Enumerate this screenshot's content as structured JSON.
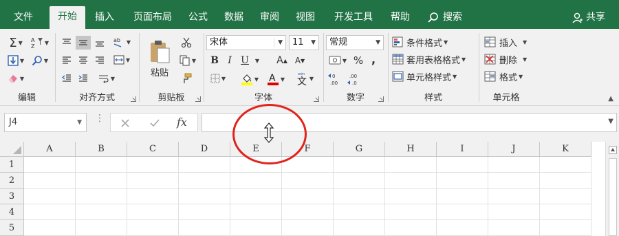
{
  "tabs": [
    "文件",
    "开始",
    "插入",
    "页面布局",
    "公式",
    "数据",
    "审阅",
    "视图",
    "开发工具",
    "帮助"
  ],
  "active_tab": "开始",
  "search_label": "搜索",
  "share_label": "共享",
  "groups": {
    "editing": "编辑",
    "alignment": "对齐方式",
    "clipboard": "剪贴板",
    "font": "字体",
    "number": "数字",
    "styles": "样式",
    "cells": "单元格"
  },
  "clipboard": {
    "paste": "粘贴"
  },
  "font": {
    "name": "宋体",
    "size": "11",
    "bold": "B",
    "italic": "I",
    "underline": "U",
    "font_color": "A",
    "grow": "A",
    "shrink": "A",
    "phonetic": "文"
  },
  "number": {
    "format": "常规",
    "percent": "%",
    "comma": ",",
    "inc_decimal": ".00",
    "dec_decimal": ".00"
  },
  "styles": {
    "conditional": "条件格式",
    "table": "套用表格格式",
    "cell_styles": "单元格样式"
  },
  "cells": {
    "insert": "插入",
    "delete": "删除",
    "format": "格式"
  },
  "formula_bar": {
    "name_box": "J4",
    "fx": "fx",
    "content": ""
  },
  "columns": [
    "A",
    "B",
    "C",
    "D",
    "E",
    "F",
    "G",
    "H",
    "I",
    "J",
    "K"
  ],
  "rows": [
    "1",
    "2",
    "3",
    "4",
    "5"
  ],
  "colors": {
    "brand": "#217346",
    "annotation": "#e0231c",
    "fill_highlight": "#ffff00",
    "font_red": "#e00000"
  }
}
